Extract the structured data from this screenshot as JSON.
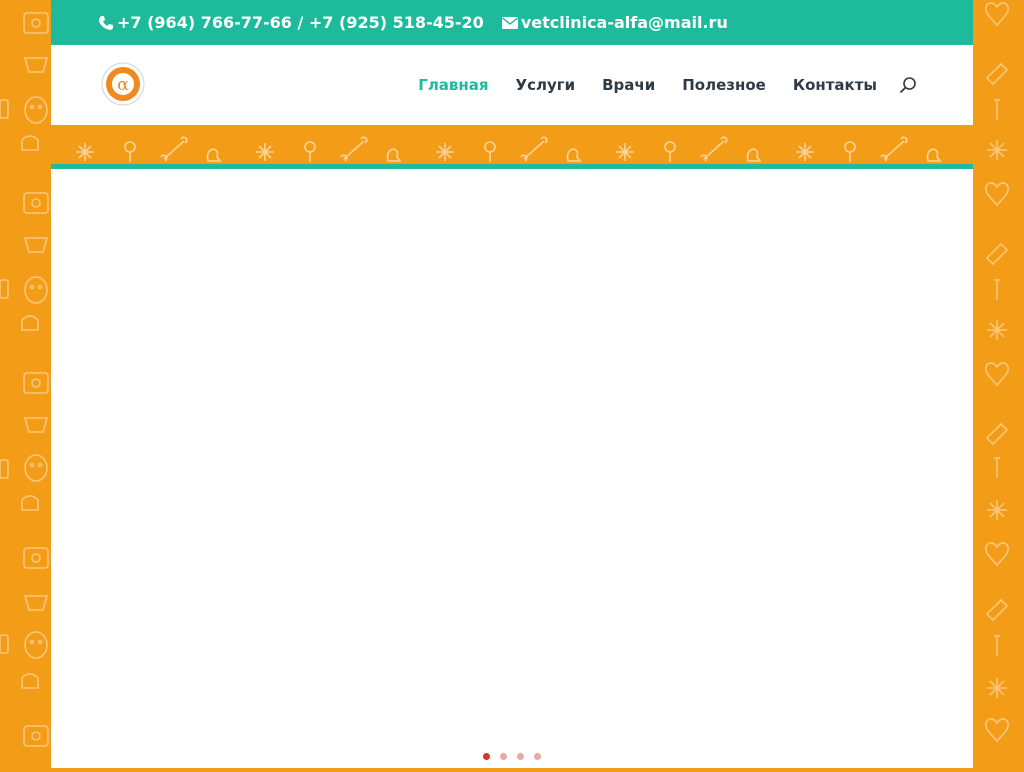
{
  "topbar": {
    "phone": "+7 (964) 766-77-66 / +7 (925) 518-45-20",
    "email": "vetclinica-alfa@mail.ru",
    "phone_icon": "phone-icon",
    "email_icon": "envelope-icon"
  },
  "header": {
    "logo_icon": "alpha-logo",
    "nav": [
      {
        "label": "Главная",
        "active": true
      },
      {
        "label": "Услуги",
        "active": false
      },
      {
        "label": "Врачи",
        "active": false
      },
      {
        "label": "Полезное",
        "active": false
      },
      {
        "label": "Контакты",
        "active": false
      }
    ],
    "search_icon": "search-icon"
  },
  "slider": {
    "slide_count": 4,
    "active_index": 0
  },
  "colors": {
    "teal": "#1dbb9b",
    "orange": "#f39c17",
    "nav_text": "#2e3a45",
    "dot_active": "#d7332b",
    "dot_inactive": "#eba7a1"
  }
}
